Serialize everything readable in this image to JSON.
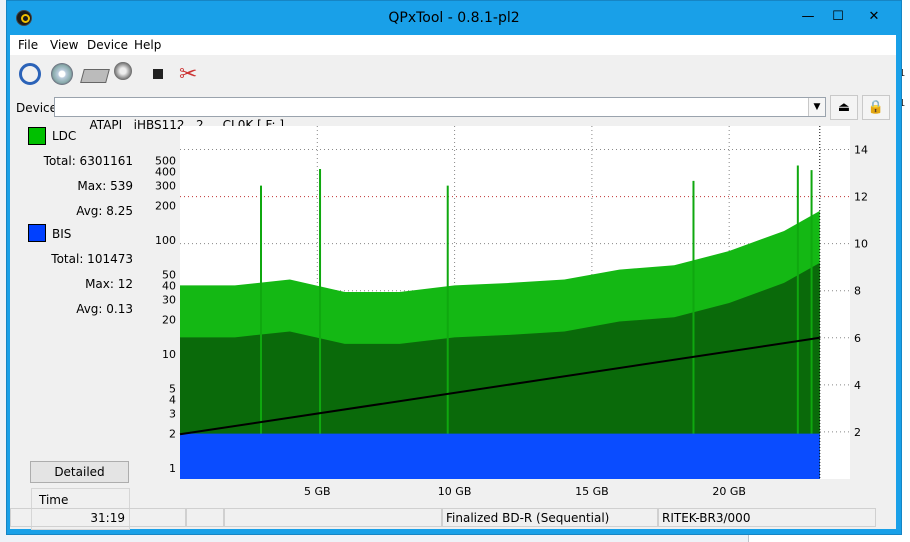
{
  "window": {
    "title": "QPxTool - 0.8.1-pl2",
    "buttons": {
      "minimize": "—",
      "maximize": "☐",
      "close": "✕"
    }
  },
  "menu": [
    "File",
    "View",
    "Device",
    "Help"
  ],
  "toolbar_icons": [
    "refresh-icon",
    "disc-info-icon",
    "drive-icon",
    "scan-icon",
    "stop-icon",
    "tools-icon"
  ],
  "device": {
    "label": "Device:",
    "value": "ATAPI   iHBS112   2     CL0K [ F: ]",
    "eject_icon": "⏏",
    "lock_icon": "🔒"
  },
  "stats": {
    "ldc": {
      "label": "LDC",
      "color": "#00c000",
      "total": "Total: 6301161",
      "max": "Max: 539",
      "avg": "Avg: 8.25"
    },
    "bis": {
      "label": "BIS",
      "color": "#0040ff",
      "total": "Total: 101473",
      "max": "Max: 12",
      "avg": "Avg: 0.13"
    }
  },
  "detailed_button": "Detailed",
  "time": {
    "label": "Time",
    "value": "31:19"
  },
  "statusbar": {
    "cell1": "",
    "cell2": "",
    "cell3": "",
    "disc": "Finalized BD-R (Sequential)",
    "media": "RITEK-BR3/000"
  },
  "chart_data": {
    "type": "area",
    "x_ticks": [
      "5 GB",
      "10 GB",
      "15 GB",
      "20 GB"
    ],
    "x_tick_values": [
      5,
      10,
      15,
      20
    ],
    "xlim": [
      0,
      24.4
    ],
    "data_end": 23.3,
    "y_left_scale": "log",
    "y_left_ticks": [
      1,
      2,
      3,
      4,
      5,
      10,
      20,
      30,
      40,
      50,
      100,
      200,
      300,
      400,
      500
    ],
    "ylim_left": [
      0.8,
      1000
    ],
    "y_right_ticks": [
      2,
      4,
      6,
      8,
      10,
      12,
      14
    ],
    "ylim_right": [
      0,
      15
    ],
    "grid": true,
    "series": [
      {
        "name": "LDC",
        "color": "#00c000",
        "x": [
          0,
          2,
          4,
          6,
          8,
          10,
          12,
          14,
          16,
          18,
          20,
          22,
          23.3
        ],
        "y": [
          40,
          40,
          45,
          35,
          35,
          40,
          42,
          45,
          55,
          60,
          80,
          120,
          180
        ]
      },
      {
        "name": "BIS",
        "color": "#0040ff",
        "x": [
          0,
          2,
          4,
          6,
          8,
          10,
          12,
          14,
          16,
          18,
          20,
          22,
          23.3
        ],
        "y": [
          2,
          2,
          2,
          2,
          2,
          2,
          2,
          2,
          2,
          2,
          2,
          2,
          2
        ]
      },
      {
        "name": "Read speed",
        "color": "#000000",
        "x": [
          0,
          23.3
        ],
        "y": [
          1.9,
          6.0
        ]
      }
    ],
    "spikes_ldc": [
      {
        "x": 2.95,
        "y": 300
      },
      {
        "x": 5.1,
        "y": 420
      },
      {
        "x": 9.75,
        "y": 300
      },
      {
        "x": 18.7,
        "y": 330
      },
      {
        "x": 22.5,
        "y": 450
      },
      {
        "x": 23.0,
        "y": 410
      }
    ]
  }
}
